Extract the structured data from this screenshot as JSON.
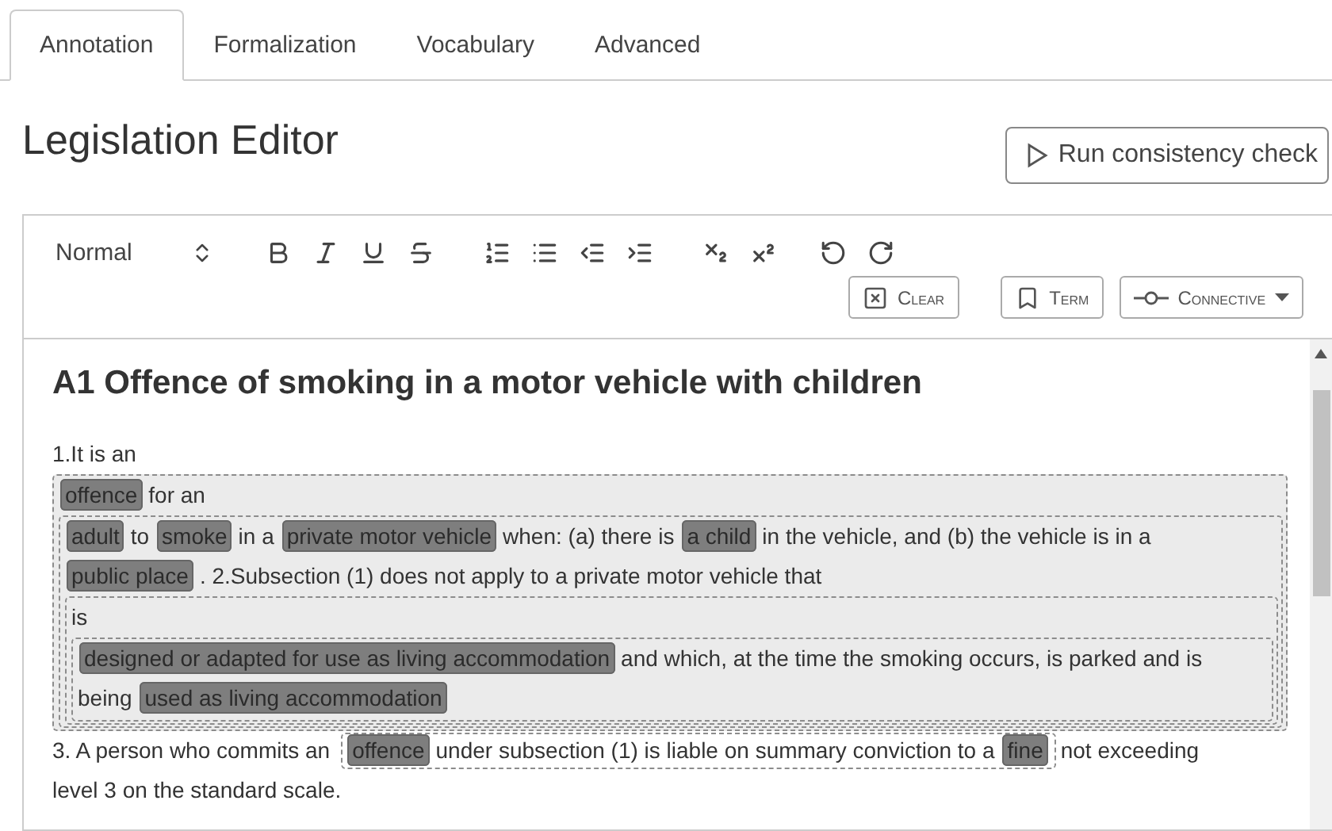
{
  "tabs": [
    {
      "label": "Annotation",
      "selected": true
    },
    {
      "label": "Formalization",
      "selected": false
    },
    {
      "label": "Vocabulary",
      "selected": false
    },
    {
      "label": "Advanced",
      "selected": false
    }
  ],
  "title": "Legislation Editor",
  "run_button": "Run consistency check",
  "toolbar": {
    "format": "Normal",
    "clear_button": "Clear",
    "term_button": "Term",
    "connective_menu": "Connective"
  },
  "document": {
    "heading": "A1 Offence of smoking in a motor vehicle with children",
    "blocks": [
      {
        "kind": "line",
        "segments": [
          {
            "kind": "plain",
            "text": "1.It is an"
          }
        ]
      },
      {
        "kind": "group",
        "blocks": [
          {
            "kind": "line",
            "segments": [
              {
                "kind": "term",
                "text": "offence"
              },
              {
                "kind": "plain",
                "text": "for an"
              }
            ]
          },
          {
            "kind": "group",
            "blocks": [
              {
                "kind": "line",
                "segments": [
                  {
                    "kind": "term",
                    "text": "adult"
                  },
                  {
                    "kind": "plain",
                    "text": "to"
                  },
                  {
                    "kind": "term",
                    "text": "smoke"
                  },
                  {
                    "kind": "plain",
                    "text": "in a"
                  },
                  {
                    "kind": "term",
                    "text": "private motor vehicle"
                  },
                  {
                    "kind": "plain",
                    "text": "when: (a) there is"
                  },
                  {
                    "kind": "term",
                    "text": "a child"
                  },
                  {
                    "kind": "plain",
                    "text": "in the vehicle, and (b) the vehicle is in a"
                  }
                ]
              },
              {
                "kind": "line",
                "segments": [
                  {
                    "kind": "term",
                    "text": "public place"
                  },
                  {
                    "kind": "plain",
                    "text": ". 2.Subsection (1) does not apply to a private motor vehicle that"
                  }
                ]
              },
              {
                "kind": "group",
                "blocks": [
                  {
                    "kind": "line",
                    "segments": [
                      {
                        "kind": "plain",
                        "text": "is"
                      }
                    ]
                  },
                  {
                    "kind": "group",
                    "blocks": [
                      {
                        "kind": "line",
                        "segments": [
                          {
                            "kind": "term",
                            "text": "designed or adapted for use as living accommodation"
                          },
                          {
                            "kind": "plain",
                            "text": "and which, at the time the smoking occurs, is parked and is"
                          }
                        ]
                      },
                      {
                        "kind": "line",
                        "segments": [
                          {
                            "kind": "plain",
                            "text": "being"
                          },
                          {
                            "kind": "term",
                            "text": "used as living accommodation"
                          }
                        ]
                      }
                    ]
                  }
                ]
              }
            ]
          }
        ]
      },
      {
        "kind": "line",
        "segments": [
          {
            "kind": "plain",
            "text": "3. A person who commits an"
          },
          {
            "kind": "group",
            "segments": [
              {
                "kind": "term",
                "text": "offence"
              },
              {
                "kind": "plain",
                "text": "under subsection (1) is liable on summary conviction to a"
              },
              {
                "kind": "term",
                "text": "fine"
              }
            ]
          },
          {
            "kind": "plain",
            "text": "not exceeding"
          }
        ]
      },
      {
        "kind": "line",
        "segments": [
          {
            "kind": "plain",
            "text": "level 3 on the standard scale."
          }
        ]
      }
    ]
  }
}
